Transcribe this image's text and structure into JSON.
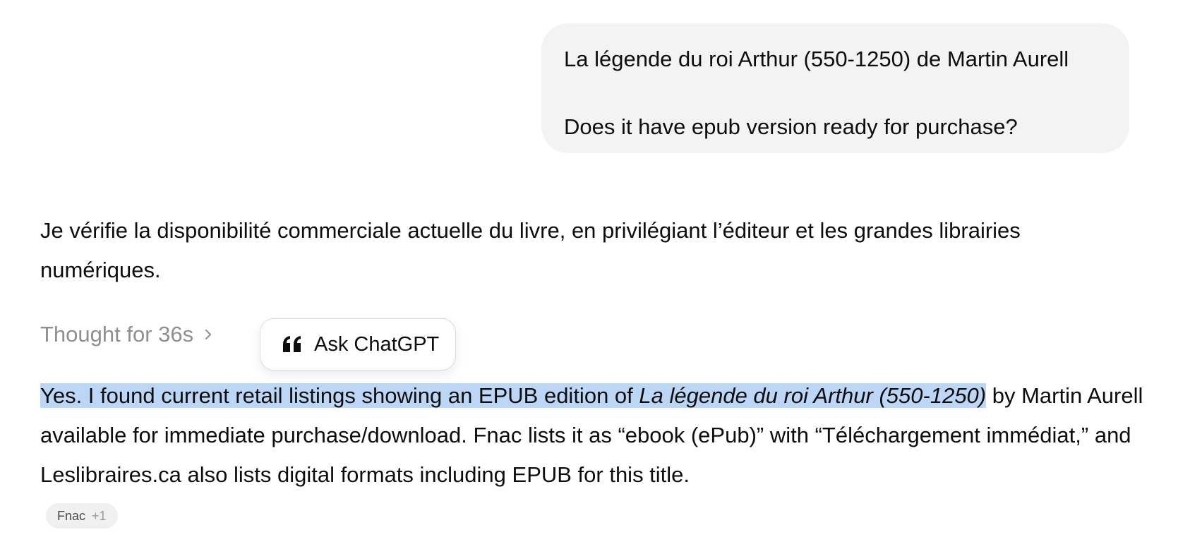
{
  "user_message": {
    "line1": "La légende du roi Arthur (550-1250) de Martin Aurell",
    "line2": "Does it have epub version ready for purchase?"
  },
  "assistant": {
    "intro": "Je vérifie la disponibilité commerciale actuelle du livre, en privilégiant l’éditeur et les grandes librairies numériques.",
    "thought_label": "Thought for 36s",
    "answer": {
      "highlight_start": "Yes. I found current retail listings showing an EPUB edition of ",
      "book_title": "La légende du roi Arthur (550-1250)",
      "rest": " by Martin Aurell available for immediate purchase/download. Fnac lists it as “ebook (ePub)” with “Téléchargement immédiat,” and Leslibraires.ca also lists digital formats including EPUB for this title."
    },
    "source_chip": {
      "label": "Fnac",
      "extra": "+1"
    }
  },
  "popover": {
    "label": "Ask ChatGPT",
    "icon": "quote-icon"
  },
  "colors": {
    "user_bubble_bg": "#f3f3f3",
    "selection_highlight": "#bcd7f6",
    "muted_text": "#8f8f8f"
  }
}
